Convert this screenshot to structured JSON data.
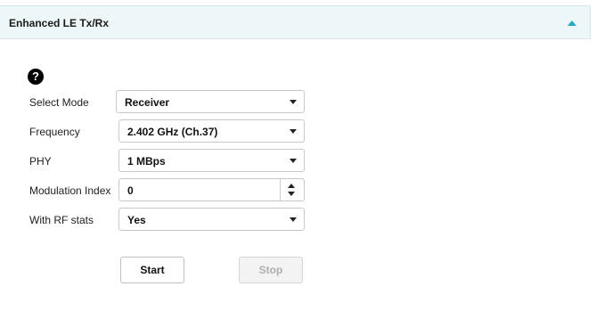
{
  "panel": {
    "title": "Enhanced LE Tx/Rx"
  },
  "help": {
    "glyph": "?"
  },
  "form": {
    "select_mode": {
      "label": "Select Mode",
      "value": "Receiver"
    },
    "frequency": {
      "label": "Frequency",
      "value": "2.402 GHz (Ch.37)"
    },
    "phy": {
      "label": "PHY",
      "value": "1 MBps"
    },
    "modulation_index": {
      "label": "Modulation Index",
      "value": "0"
    },
    "rf_stats": {
      "label": "With RF stats",
      "value": "Yes"
    }
  },
  "buttons": {
    "start": "Start",
    "stop": "Stop"
  }
}
